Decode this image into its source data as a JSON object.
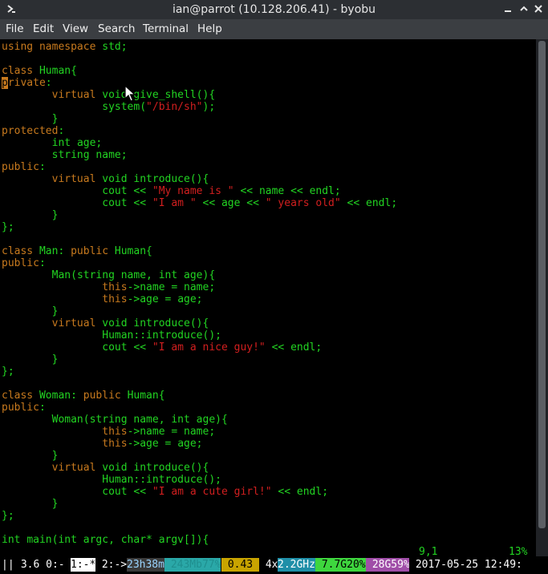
{
  "window": {
    "title": "ian@parrot (10.128.206.41) - byobu",
    "menu_icon": "terminal-icon",
    "minimize_icon": "minimize-icon",
    "maximize_icon": "maximize-icon",
    "close_icon": "close-icon"
  },
  "menu": [
    "File",
    "Edit",
    "View",
    "Search",
    "Terminal",
    "Help"
  ],
  "code": [
    {
      "t": "using namespace std;"
    },
    {
      "t": ""
    },
    {
      "t": "class Human{"
    },
    {
      "t": "private:"
    },
    {
      "t": "        virtual void give_shell(){"
    },
    {
      "t": "                system(\"/bin/sh\");"
    },
    {
      "t": "        }"
    },
    {
      "t": "protected:"
    },
    {
      "t": "        int age;"
    },
    {
      "t": "        string name;"
    },
    {
      "t": "public:"
    },
    {
      "t": "        virtual void introduce(){"
    },
    {
      "t": "                cout << \"My name is \" << name << endl;"
    },
    {
      "t": "                cout << \"I am \" << age << \" years old\" << endl;"
    },
    {
      "t": "        }"
    },
    {
      "t": "};"
    },
    {
      "t": ""
    },
    {
      "t": "class Man: public Human{"
    },
    {
      "t": "public:"
    },
    {
      "t": "        Man(string name, int age){"
    },
    {
      "t": "                this->name = name;"
    },
    {
      "t": "                this->age = age;"
    },
    {
      "t": "        }"
    },
    {
      "t": "        virtual void introduce(){"
    },
    {
      "t": "                Human::introduce();"
    },
    {
      "t": "                cout << \"I am a nice guy!\" << endl;"
    },
    {
      "t": "        }"
    },
    {
      "t": "};"
    },
    {
      "t": ""
    },
    {
      "t": "class Woman: public Human{"
    },
    {
      "t": "public:"
    },
    {
      "t": "        Woman(string name, int age){"
    },
    {
      "t": "                this->name = name;"
    },
    {
      "t": "                this->age = age;"
    },
    {
      "t": "        }"
    },
    {
      "t": "        virtual void introduce(){"
    },
    {
      "t": "                Human::introduce();"
    },
    {
      "t": "                cout << \"I am a cute girl!\" << endl;"
    },
    {
      "t": "        }"
    },
    {
      "t": "};"
    },
    {
      "t": ""
    },
    {
      "t": "int main(int argc, char* argv[]){"
    }
  ],
  "vim_status": {
    "position": "9,1",
    "percent": "13%"
  },
  "byobu": {
    "segments": [
      {
        "text": "||",
        "fg": "#ffffff",
        "bg": "#000000"
      },
      {
        "text": " 3.6 0:- ",
        "fg": "#ffffff",
        "bg": "#000000"
      },
      {
        "text": "1:-*",
        "fg": "#000000",
        "bg": "#ffffff"
      },
      {
        "text": " 2:->",
        "fg": "#ffffff",
        "bg": "#000000"
      },
      {
        "text": "23h38m",
        "fg": "#9ad4ff",
        "bg": "#3a3a3a"
      },
      {
        "text": " 243Mb77%",
        "fg": "#1f8f8f",
        "bg": "#2aa8a8"
      },
      {
        "text": " 0.43 ",
        "fg": "#000000",
        "bg": "#c8a400"
      },
      {
        "text": " 4x",
        "fg": "#ffffff",
        "bg": "#000000"
      },
      {
        "text": "2.2GHz",
        "fg": "#ffffff",
        "bg": "#1f8fa8"
      },
      {
        "text": " 7.7G20%",
        "fg": "#000000",
        "bg": "#3ed63e"
      },
      {
        "text": " 28G59%",
        "fg": "#ffffff",
        "bg": "#a04ea8"
      },
      {
        "text": " 2017-05-25 12:49:",
        "fg": "#ffffff",
        "bg": "#000000"
      }
    ]
  }
}
